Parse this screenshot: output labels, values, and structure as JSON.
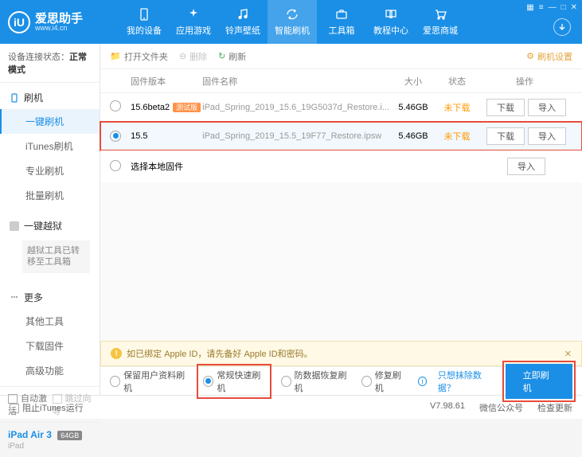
{
  "brand": {
    "name": "爱思助手",
    "url": "www.i4.cn",
    "logo_letter": "iU"
  },
  "nav": [
    {
      "label": "我的设备"
    },
    {
      "label": "应用游戏"
    },
    {
      "label": "铃声壁纸"
    },
    {
      "label": "智能刷机"
    },
    {
      "label": "工具箱"
    },
    {
      "label": "教程中心"
    },
    {
      "label": "爱思商城"
    }
  ],
  "sidebar": {
    "status_label": "设备连接状态：",
    "status_value": "正常模式",
    "groups": [
      {
        "head": "刷机",
        "items": [
          "一键刷机",
          "iTunes刷机",
          "专业刷机",
          "批量刷机"
        ]
      },
      {
        "head": "一键越狱",
        "note": "越狱工具已转移至工具箱"
      },
      {
        "head": "更多",
        "items": [
          "其他工具",
          "下载固件",
          "高级功能"
        ]
      }
    ],
    "auto_activate": "自动激活",
    "skip_guide": "跳过向导",
    "device": {
      "name": "iPad Air 3",
      "storage": "64GB",
      "type": "iPad"
    }
  },
  "toolbar": {
    "open_folder": "打开文件夹",
    "delete": "删除",
    "refresh": "刷新",
    "settings": "刷机设置"
  },
  "table": {
    "headers": {
      "version": "固件版本",
      "name": "固件名称",
      "size": "大小",
      "status": "状态",
      "ops": "操作"
    },
    "rows": [
      {
        "version": "15.6beta2",
        "beta": "测试版",
        "name": "iPad_Spring_2019_15.6_19G5037d_Restore.i...",
        "size": "5.46GB",
        "status": "未下载",
        "selected": false
      },
      {
        "version": "15.5",
        "name": "iPad_Spring_2019_15.5_19F77_Restore.ipsw",
        "size": "5.46GB",
        "status": "未下载",
        "selected": true
      }
    ],
    "local_label": "选择本地固件",
    "btn_download": "下载",
    "btn_import": "导入"
  },
  "warning": "如已绑定 Apple ID，请先备好 Apple ID和密码。",
  "flash_opts": {
    "keep_data": "保留用户资料刷机",
    "normal": "常规快速刷机",
    "recovery": "防数据恢复刷机",
    "repair": "修复刷机",
    "exclude_link": "只想抹除数据？",
    "go_btn": "立即刷机"
  },
  "statusbar": {
    "block_itunes": "阻止iTunes运行",
    "version": "V7.98.61",
    "wechat": "微信公众号",
    "check_update": "检查更新"
  }
}
